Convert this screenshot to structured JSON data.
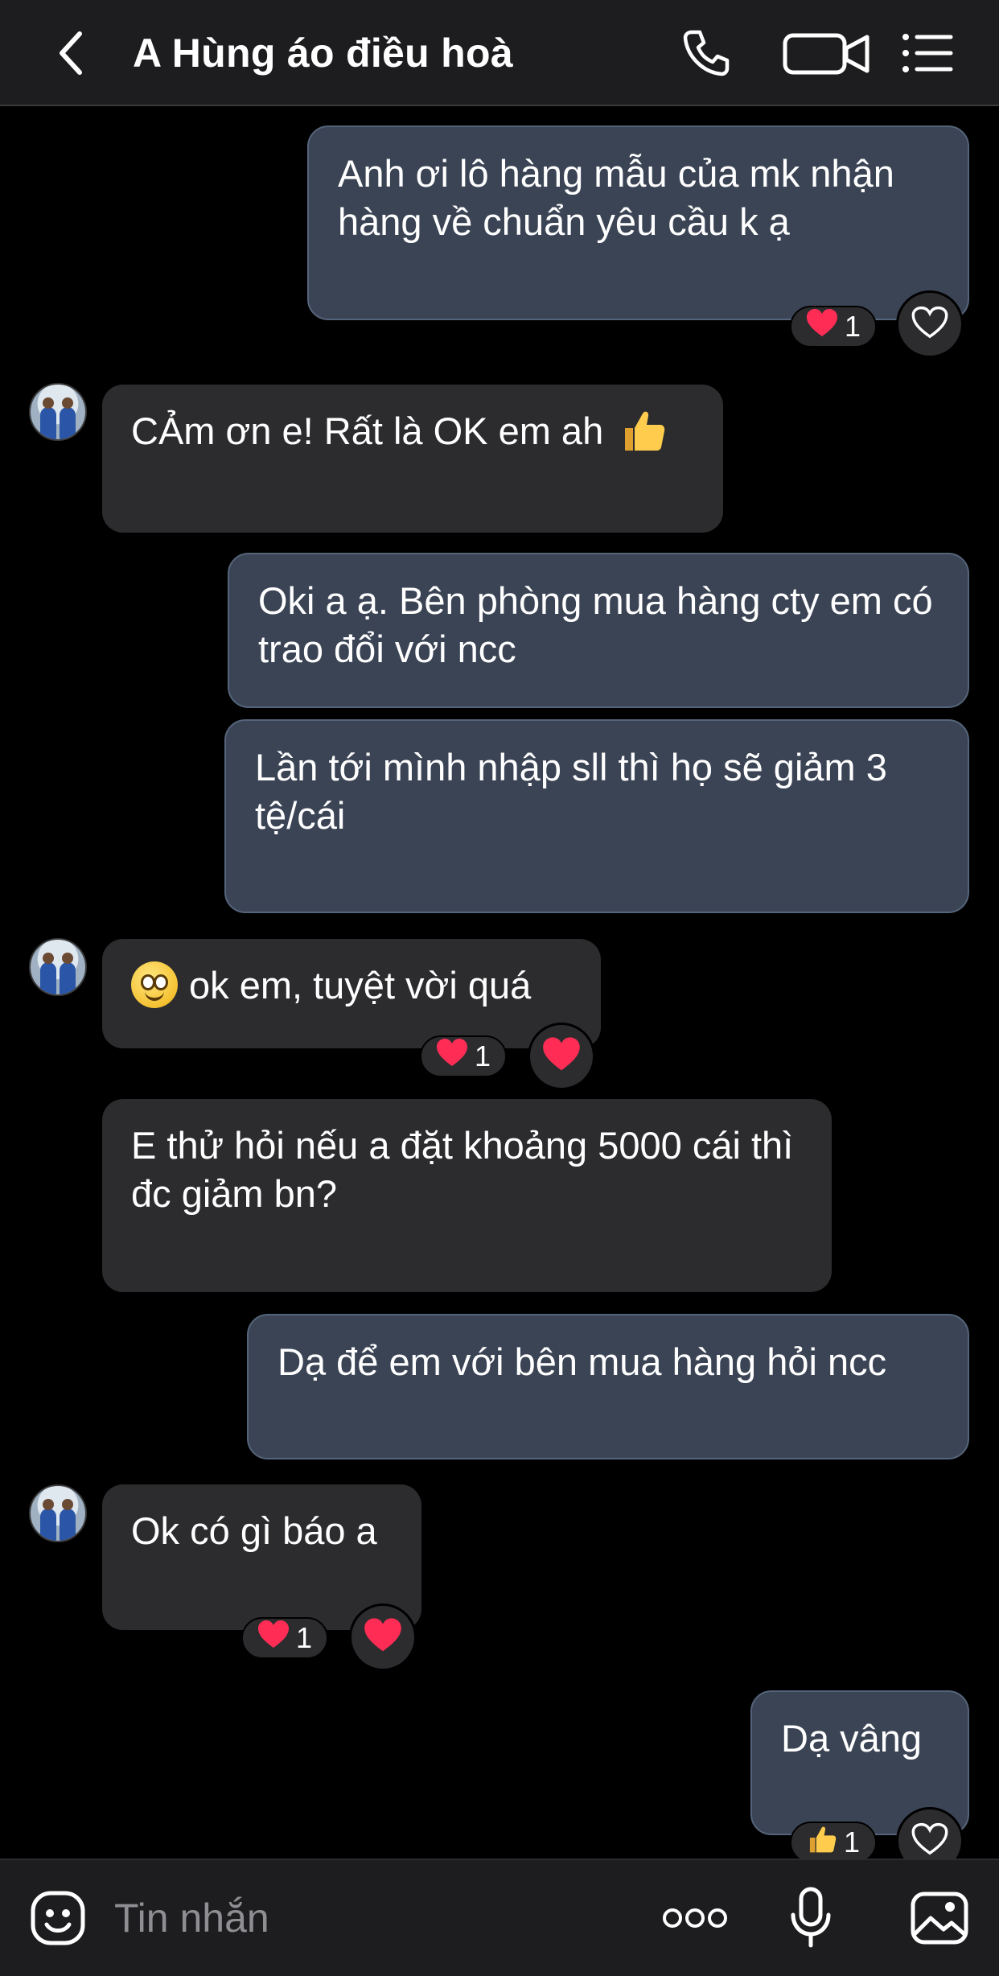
{
  "header": {
    "title": "A Hùng áo điều hoà"
  },
  "messages": [
    {
      "text": "Anh ơi lô hàng mẫu của mk nhận hàng về chuẩn yêu cầu k ạ",
      "reaction_count": "1"
    },
    {
      "text": "CẢm ơn e! Rất là OK em ah"
    },
    {
      "text": "Oki a ạ. Bên phòng mua hàng cty em có trao đổi với ncc"
    },
    {
      "text": "Lần tới mình nhập sll thì họ sẽ giảm 3 tệ/cái"
    },
    {
      "text": "ok em, tuyệt vời quá",
      "reaction_count": "1"
    },
    {
      "text": "E thử hỏi nếu a đặt khoảng 5000 cái thì đc giảm bn?"
    },
    {
      "text": "Dạ để em với bên mua hàng hỏi ncc"
    },
    {
      "text": "Ok có gì báo a",
      "reaction_count": "1"
    },
    {
      "text": "Dạ vâng",
      "reaction_count": "1"
    }
  ],
  "input": {
    "placeholder": "Tin nhắn"
  },
  "icons": {
    "back": "chevron-left-icon",
    "call": "phone-icon",
    "video": "video-camera-icon",
    "menu": "list-icon",
    "sticker": "sticker-face-icon",
    "more": "more-dots-icon",
    "mic": "microphone-icon",
    "image": "image-gallery-icon"
  },
  "colors": {
    "outgoing_bubble": "#3b4455",
    "incoming_bubble": "#2c2c2e",
    "heart": "#ff2d55"
  }
}
